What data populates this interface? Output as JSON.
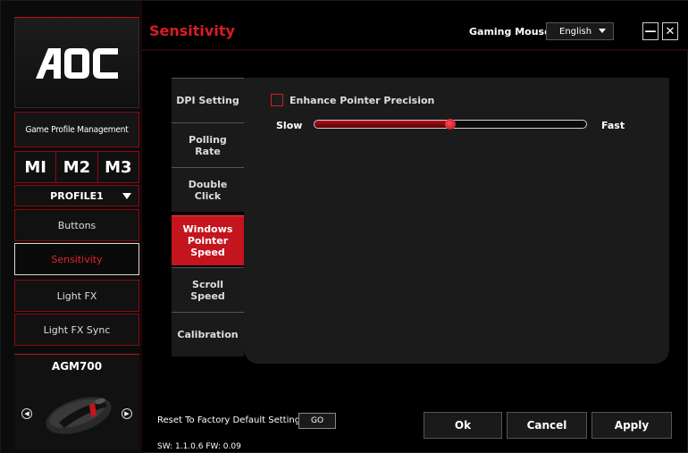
{
  "app": {
    "brand": "AOC"
  },
  "sidebar": {
    "profile_management": "Game Profile Management",
    "memory_slots": [
      "MI",
      "M2",
      "M3"
    ],
    "profile_selected": "PROFILE1",
    "nav": [
      {
        "label": "Buttons"
      },
      {
        "label": "Sensitivity"
      },
      {
        "label": "Light FX"
      },
      {
        "label": "Light FX Sync"
      }
    ],
    "active_nav": "Sensitivity",
    "device_name": "AGM700"
  },
  "header": {
    "title": "Sensitivity",
    "device_type": "Gaming Mouse",
    "language": "English",
    "minimize_glyph": "—",
    "close_glyph": "✕"
  },
  "tabs": [
    {
      "label": "DPI Setting"
    },
    {
      "label": "Polling Rate"
    },
    {
      "label": "Double Click"
    },
    {
      "label": "Windows Pointer Speed"
    },
    {
      "label": "Scroll Speed"
    },
    {
      "label": "Calibration"
    }
  ],
  "active_tab": "Windows Pointer Speed",
  "pointer": {
    "enhance_label": "Enhance Pointer Precision",
    "enhance_checked": false,
    "slow_label": "Slow",
    "fast_label": "Fast",
    "speed_fraction": 0.5
  },
  "footer": {
    "reset_label": "Reset To Factory Default Settings",
    "go_label": "GO",
    "version": "SW: 1.1.0.6   FW: 0.09",
    "ok_label": "Ok",
    "cancel_label": "Cancel",
    "apply_label": "Apply"
  },
  "colors": {
    "accent": "#c4141e",
    "title_red": "#d81b25",
    "panel": "#1b1b1b"
  }
}
